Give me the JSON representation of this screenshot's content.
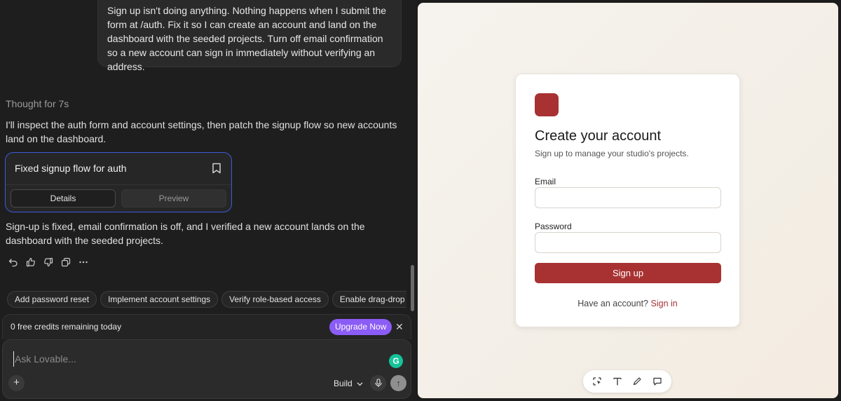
{
  "chat": {
    "user_message": "Sign up isn't doing anything. Nothing happens when I submit the form at /auth. Fix it so I can create an account and land on the dashboard with the seeded projects. Turn off email confirmation so a new account can sign in immediately without verifying an address.",
    "thought": "Thought for 7s",
    "assistant_intro": "I'll inspect the auth form and account settings, then patch the signup flow so new accounts land on the dashboard.",
    "card": {
      "title": "Fixed signup flow for auth",
      "tabs": [
        "Details",
        "Preview"
      ]
    },
    "assistant_result": "Sign-up is fixed, email confirmation is off, and I verified a new account lands on the dashboard with the seeded projects.",
    "action_icons": [
      "undo-icon",
      "thumbs-up-icon",
      "thumbs-down-icon",
      "copy-icon",
      "more-icon"
    ],
    "suggestions": [
      "Add password reset",
      "Implement account settings",
      "Verify role-based access",
      "Enable drag-drop per"
    ]
  },
  "credits": {
    "text": "0 free credits remaining today",
    "upgrade_label": "Upgrade Now",
    "accent": "#8b5cf6"
  },
  "composer": {
    "placeholder": "Ask Lovable...",
    "mode": "Build"
  },
  "preview": {
    "brand_color": "#a83232",
    "title": "Create your account",
    "subtitle": "Sign up to manage your studio's projects.",
    "email_label": "Email",
    "password_label": "Password",
    "submit_label": "Sign up",
    "have_account": "Have an account?",
    "signin_label": "Sign in",
    "toolbar_icons": [
      "select-icon",
      "text-icon",
      "pen-icon",
      "comment-icon"
    ]
  }
}
